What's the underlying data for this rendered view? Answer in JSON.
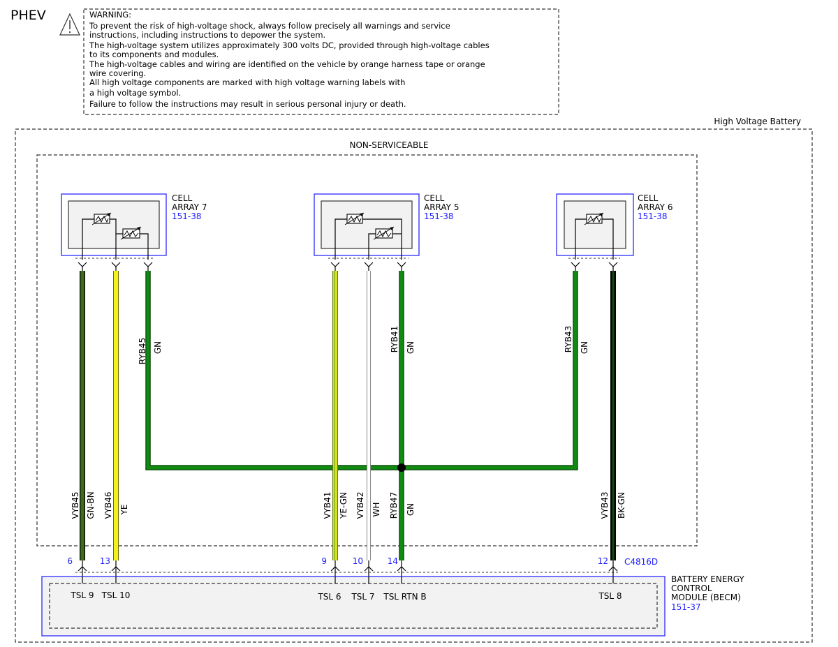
{
  "header": {
    "title": "PHEV",
    "warning_lines": [
      "WARNING:",
      "To prevent the risk of high-voltage shock, always follow precisely all warnings and service",
      "instructions, including instructions to depower the system.",
      "The high-voltage system utilizes approximately 300 volts DC, provided through high-voltage cables",
      "to its components and modules.",
      "The high-voltage cables and wiring are identified on the vehicle by orange harness tape or orange",
      "wire covering.",
      "All high voltage components are marked with high voltage warning labels with",
      "a high voltage symbol.",
      "Failure to follow the instructions may result in serious personal injury or death."
    ]
  },
  "enclosure": {
    "outer_label": "High Voltage Battery",
    "inner_label": "NON-SERVICEABLE"
  },
  "components": {
    "cell_array_7": {
      "line1": "CELL",
      "line2": "ARRAY 7",
      "ref": "151-38"
    },
    "cell_array_5": {
      "line1": "CELL",
      "line2": "ARRAY 5",
      "ref": "151-38"
    },
    "cell_array_6": {
      "line1": "CELL",
      "line2": "ARRAY 6",
      "ref": "151-38"
    },
    "becm": {
      "line1": "BATTERY ENERGY",
      "line2": "CONTROL",
      "line3": "MODULE (BECM)",
      "ref": "151-37",
      "connector": "C4816D"
    }
  },
  "wires": {
    "upper": [
      {
        "circuit": "RYB45",
        "color": "GN"
      },
      {
        "circuit": "RYB41",
        "color": "GN"
      },
      {
        "circuit": "RYB43",
        "color": "GN"
      }
    ],
    "lower": [
      {
        "circuit": "VYB45",
        "color": "GN-BN",
        "pin": "6",
        "terminal": "TSL 9"
      },
      {
        "circuit": "VYB46",
        "color": "YE",
        "pin": "13",
        "terminal": "TSL 10"
      },
      {
        "circuit": "VYB41",
        "color": "YE-GN",
        "pin": "9",
        "terminal": "TSL 6"
      },
      {
        "circuit": "VYB42",
        "color": "WH",
        "pin": "10",
        "terminal": "TSL 7"
      },
      {
        "circuit": "RYB47",
        "color": "GN",
        "pin": "14",
        "terminal": "TSL RTN B"
      },
      {
        "circuit": "VYB43",
        "color": "BK-GN",
        "pin": "12",
        "terminal": "TSL 8"
      }
    ]
  },
  "colors": {
    "green": "#118a11",
    "green_brown": "#3f6b1f",
    "yellow": "#f2f21a",
    "yellow_green": "#d7e21a",
    "white": "#e2e2e2",
    "black_green": "#0b2b0b",
    "component_border": "#2a2aff",
    "ref_text": "#1a1aff"
  },
  "icons": [
    "warning-triangle-icon",
    "thermistor-icon",
    "connector-pin-icon",
    "splice-dot-icon"
  ]
}
